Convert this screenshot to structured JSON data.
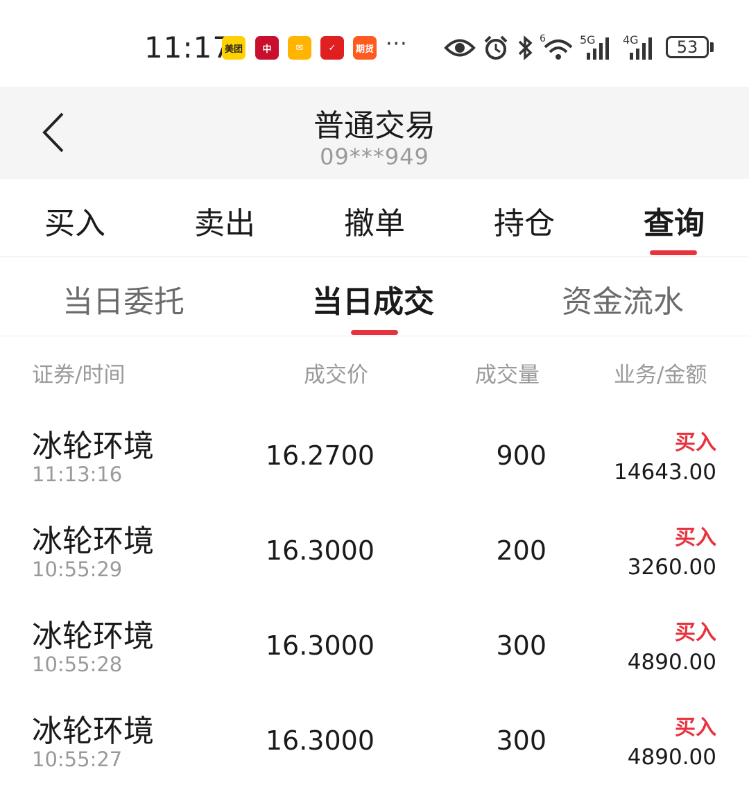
{
  "status_bar": {
    "time": "11:17",
    "apps": [
      {
        "name": "meituan-icon",
        "label": "美团",
        "color": "#ffd100",
        "text_color": "#222222"
      },
      {
        "name": "bank-of-china-icon",
        "label": "中",
        "color": "#c8102e",
        "text_color": "#ffffff"
      },
      {
        "name": "mail-icon",
        "label": "✉",
        "color": "#ffb400",
        "text_color": "#ffffff"
      },
      {
        "name": "broker-app-icon",
        "label": "✓",
        "color": "#e02020",
        "text_color": "#ffffff"
      },
      {
        "name": "futures-app-icon",
        "label": "期货",
        "color": "#ff5a1f",
        "text_color": "#ffffff"
      }
    ],
    "more": "···",
    "network_5g": "5G",
    "network_4g": "4G",
    "wifi_sup": "6",
    "battery": "53"
  },
  "header": {
    "title": "普通交易",
    "account": "09***949"
  },
  "main_tabs": [
    {
      "label": "买入",
      "active": false
    },
    {
      "label": "卖出",
      "active": false
    },
    {
      "label": "撤单",
      "active": false
    },
    {
      "label": "持仓",
      "active": false
    },
    {
      "label": "查询",
      "active": true
    }
  ],
  "sub_tabs": [
    {
      "label": "当日委托",
      "active": false
    },
    {
      "label": "当日成交",
      "active": true
    },
    {
      "label": "资金流水",
      "active": false
    }
  ],
  "table": {
    "headers": {
      "security_time": "证券/时间",
      "price": "成交价",
      "quantity": "成交量",
      "business_amount": "业务/金额"
    },
    "rows": [
      {
        "name": "冰轮环境",
        "time": "11:13:16",
        "price": "16.2700",
        "quantity": "900",
        "business": "买入",
        "amount": "14643.00"
      },
      {
        "name": "冰轮环境",
        "time": "10:55:29",
        "price": "16.3000",
        "quantity": "200",
        "business": "买入",
        "amount": "3260.00"
      },
      {
        "name": "冰轮环境",
        "time": "10:55:28",
        "price": "16.3000",
        "quantity": "300",
        "business": "买入",
        "amount": "4890.00"
      },
      {
        "name": "冰轮环境",
        "time": "10:55:27",
        "price": "16.3000",
        "quantity": "300",
        "business": "买入",
        "amount": "4890.00"
      }
    ]
  },
  "colors": {
    "accent": "#e8333f",
    "buy": "#e8333f",
    "muted_text": "#9a9a9a",
    "header_bg": "#f5f5f5"
  }
}
